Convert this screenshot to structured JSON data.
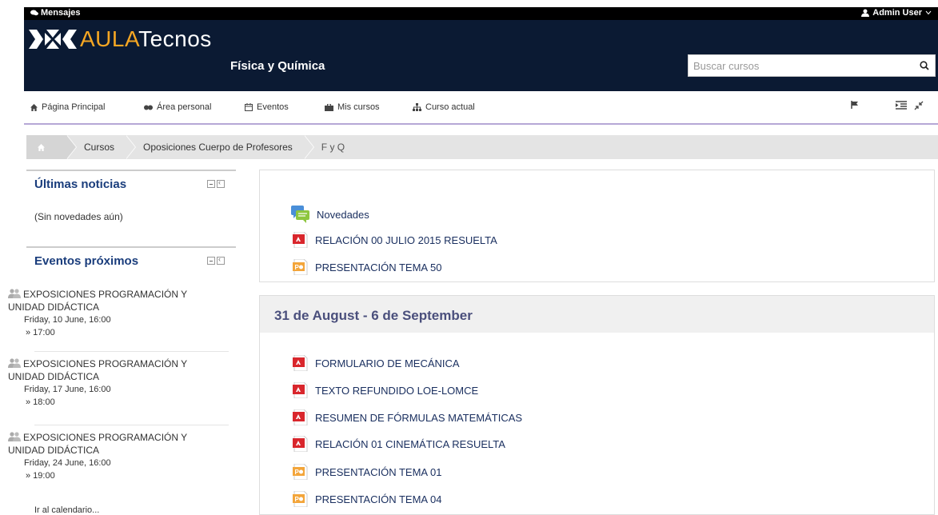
{
  "topbar": {
    "messages": "Mensajes",
    "user": "Admin User"
  },
  "header": {
    "logo_a": "AULA",
    "logo_b": "Tecnos",
    "course": "Física y Química",
    "search_placeholder": "Buscar cursos"
  },
  "nav": [
    {
      "icon": "home-icon",
      "label": "Página Principal"
    },
    {
      "icon": "dashboard-icon",
      "label": "Área personal"
    },
    {
      "icon": "calendar-icon",
      "label": "Eventos"
    },
    {
      "icon": "briefcase-icon",
      "label": "Mis cursos"
    },
    {
      "icon": "sitemap-icon",
      "label": "Curso actual"
    }
  ],
  "breadcrumb": [
    "Cursos",
    "Oposiciones Cuerpo de Profesores",
    "F y Q"
  ],
  "news": {
    "title": "Últimas noticias",
    "empty": "(Sin novedades aún)"
  },
  "events": {
    "title": "Eventos próximos",
    "items": [
      {
        "line1": "EXPOSICIONES PROGRAMACIÓN Y",
        "line2": "UNIDAD DIDÁCTICA",
        "date": "Friday, 10 June, 16:00",
        "end": "» 17:00"
      },
      {
        "line1": "EXPOSICIONES PROGRAMACIÓN Y",
        "line2": "UNIDAD DIDÁCTICA",
        "date": "Friday, 17 June, 16:00",
        "end": "» 18:00"
      },
      {
        "line1": "EXPOSICIONES PROGRAMACIÓN Y",
        "line2": "UNIDAD DIDÁCTICA",
        "date": "Friday, 24 June, 16:00",
        "end": "» 19:00"
      }
    ],
    "calendar_link": "Ir al calendario..."
  },
  "section0": [
    {
      "type": "forum",
      "label": "Novedades"
    },
    {
      "type": "pdf",
      "label": "RELACIÓN 00 JULIO 2015 RESUELTA"
    },
    {
      "type": "ppt",
      "label": "PRESENTACIÓN TEMA 50"
    }
  ],
  "section1": {
    "title": "31 de August - 6 de September",
    "items": [
      {
        "type": "pdf",
        "label": "FORMULARIO DE MECÁNICA"
      },
      {
        "type": "pdf",
        "label": "TEXTO REFUNDIDO LOE-LOMCE"
      },
      {
        "type": "pdf",
        "label": "RESUMEN DE FÓRMULAS MATEMÁTICAS"
      },
      {
        "type": "pdf",
        "label": "RELACIÓN 01 CINEMÁTICA RESUELTA"
      },
      {
        "type": "ppt",
        "label": "PRESENTACIÓN TEMA 01"
      },
      {
        "type": "ppt",
        "label": "PRESENTACIÓN TEMA 04"
      }
    ]
  },
  "colors": {
    "header_bg": "#0b1a33",
    "accent": "#f5a623",
    "link": "#1b3060",
    "section_title": "#4a4f7c"
  }
}
